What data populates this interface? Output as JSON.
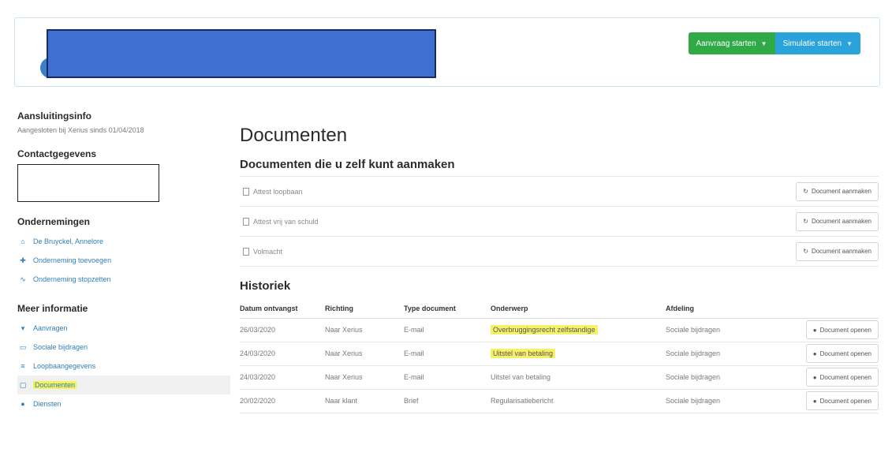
{
  "header": {
    "buttons": [
      {
        "label": "Aanvraag starten",
        "color": "#2faa46"
      },
      {
        "label": "Simulatie starten",
        "color": "#2aa3dc"
      }
    ]
  },
  "sidebar": {
    "membership": {
      "title": "Aansluitingsinfo",
      "subtitle": "Aangesloten bij Xerius sinds 01/04/2018"
    },
    "contact": {
      "title": "Contactgegevens"
    },
    "companies": {
      "title": "Ondernemingen",
      "items": [
        {
          "label": "De Bruyckel, Annelore",
          "icon": "home-icon"
        },
        {
          "label": "Onderneming toevoegen",
          "icon": "plus-icon"
        },
        {
          "label": "Onderneming stopzetten",
          "icon": "link-icon"
        }
      ]
    },
    "more": {
      "title": "Meer informatie",
      "items": [
        {
          "label": "Aanvragen",
          "icon": "inbox-icon"
        },
        {
          "label": "Sociale bijdragen",
          "icon": "card-icon"
        },
        {
          "label": "Loopbaangegevens",
          "icon": "list-icon"
        },
        {
          "label": "Documenten",
          "icon": "document-icon",
          "active": true
        },
        {
          "label": "Diensten",
          "icon": "globe-icon"
        }
      ]
    }
  },
  "main": {
    "title": "Documenten",
    "create_section": {
      "title": "Documenten die u zelf kunt aanmaken",
      "button_label": "Document aanmaken",
      "items": [
        "Attest loopbaan",
        "Attest vrij van schuld",
        "Volmacht"
      ]
    },
    "history": {
      "title": "Historiek",
      "columns": [
        "Datum ontvangst",
        "Richting",
        "Type document",
        "Onderwerp",
        "Afdeling"
      ],
      "button_label": "Document openen",
      "rows": [
        {
          "date": "26/03/2020",
          "direction": "Naar Xerius",
          "type": "E-mail",
          "subject": "Overbruggingsrecht zelfstandige",
          "department": "Sociale bijdragen",
          "highlight": true
        },
        {
          "date": "24/03/2020",
          "direction": "Naar Xerius",
          "type": "E-mail",
          "subject": "Uitstel van betaling",
          "department": "Sociale bijdragen",
          "highlight": true
        },
        {
          "date": "24/03/2020",
          "direction": "Naar Xerius",
          "type": "E-mail",
          "subject": "Uitstel van betaling",
          "department": "Sociale bijdragen",
          "highlight": false
        },
        {
          "date": "20/02/2020",
          "direction": "Naar klant",
          "type": "Brief",
          "subject": "Regularisatiebericht",
          "department": "Sociale bijdragen",
          "highlight": false
        }
      ]
    }
  },
  "colors": {
    "accent_green": "#2faa46",
    "accent_blue": "#2aa3dc",
    "highlight": "#f5f26a",
    "link": "#2f7fb8"
  }
}
